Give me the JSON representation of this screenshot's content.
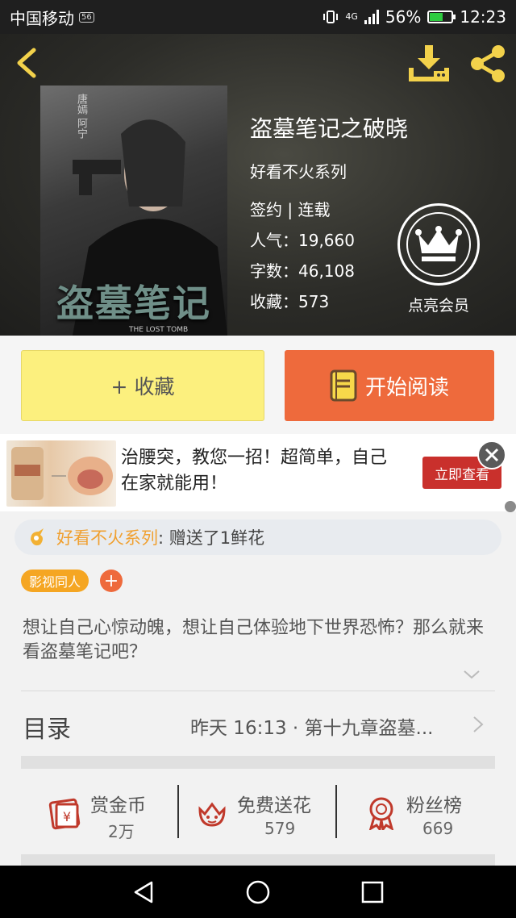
{
  "status_bar": {
    "carrier": "中国移动",
    "network_badge": "56",
    "signal_type": "4G",
    "battery_percent": "56%",
    "battery_level": 0.56,
    "time": "12:23"
  },
  "header": {
    "back_icon": "chevron-left-icon",
    "download_icon": "download-icon",
    "share_icon": "share-icon",
    "accent_color": "#f3d24b"
  },
  "book": {
    "cover_author": "唐嫣 阿宁",
    "cover_title": "盗墓笔记",
    "cover_subtitle": "THE LOST TOMB",
    "title": "盗墓笔记之破晓",
    "series": "好看不火系列",
    "status": "签约 | 连载",
    "popularity": "人气：19,660",
    "words": "字数：46,108",
    "favorites": "收藏：573"
  },
  "vip": {
    "label": "点亮会员",
    "icon": "crown-icon"
  },
  "actions": {
    "favorite_label": "+ 收藏",
    "read_label": "开始阅读",
    "read_icon": "book-icon",
    "favorite_color": "#fcf07e",
    "read_color": "#ee6a3c"
  },
  "ad": {
    "text": "治腰突，教您一招！超简单，自己在家就能用！",
    "button_label": "立即查看",
    "close_icon": "close-icon"
  },
  "flower_message": {
    "icon": "flower-icon",
    "sender": "好看不火系列",
    "text": ": 赠送了1鲜花"
  },
  "tags": {
    "items": [
      "影视同人"
    ],
    "add_label": "+"
  },
  "description": "想让自己心惊动魄，想让自己体验地下世界恐怖？那么就来看盗墓笔记吧？",
  "toc": {
    "label": "目录",
    "latest": "昨天 16:13 · 第十九章盗墓..."
  },
  "stats": [
    {
      "title": "赏金币",
      "value": "2万",
      "icon": "reward-icon"
    },
    {
      "title": "免费送花",
      "value": "579",
      "icon": "flower-gift-icon"
    },
    {
      "title": "粉丝榜",
      "value": "669",
      "icon": "medal-icon"
    }
  ],
  "nav": [
    "back-nav-icon",
    "home-nav-icon",
    "recents-nav-icon"
  ]
}
